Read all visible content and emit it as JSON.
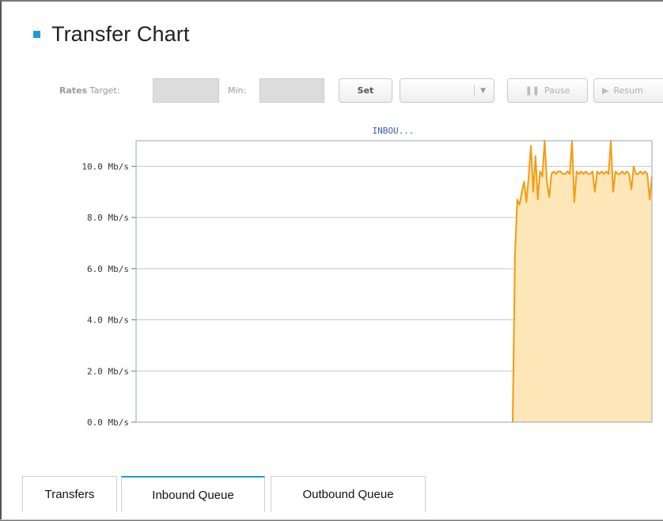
{
  "header": {
    "title": "Transfer Chart"
  },
  "toolbar": {
    "rates_label": "Rates",
    "target_label": "Target:",
    "min_label": "Min:",
    "set_label": "Set",
    "pause_label": "Pause",
    "resume_label": "Resum",
    "target_value": "",
    "min_value": "",
    "select_value": ""
  },
  "icons": {
    "title_bullet": "square-bullet-icon",
    "select_arrow": "chevron-down-icon",
    "pause": "pause-icon",
    "resume": "play-icon"
  },
  "colors": {
    "accent": "#1f9ad8",
    "series_line": "#f39c12",
    "series_fill": "#fde7b8",
    "grid": "#c0c7d6"
  },
  "chart_data": {
    "type": "area",
    "series_label": "INBOU...",
    "y_ticks": [
      "0.0 Mb/s",
      "2.0 Mb/s",
      "4.0 Mb/s",
      "6.0 Mb/s",
      "8.0 Mb/s",
      "10.0 Mb/s"
    ],
    "ylim": [
      0,
      11.0
    ],
    "grid": true,
    "series": [
      {
        "values": [
          0,
          0,
          0,
          0,
          0,
          0,
          0,
          0,
          0,
          0,
          0,
          0,
          0,
          0,
          0,
          0,
          0,
          0,
          0,
          0,
          0,
          0,
          0,
          0,
          0,
          0,
          0,
          0,
          0,
          0,
          0,
          0,
          0,
          0,
          0,
          0,
          0,
          0,
          0,
          0,
          0,
          0,
          0,
          0,
          0,
          0,
          0,
          0,
          0,
          0,
          0,
          0,
          0,
          0,
          0,
          0,
          0,
          0,
          0,
          0,
          0,
          0,
          0,
          0,
          0,
          0,
          0,
          0,
          0,
          0,
          0,
          0,
          0,
          0,
          0,
          0,
          0,
          0,
          0,
          0,
          0,
          0,
          0,
          0,
          0,
          0,
          0,
          0,
          0,
          0,
          0,
          0,
          0,
          0,
          0,
          0,
          0,
          0,
          0,
          0,
          0,
          0,
          0,
          0,
          0,
          0,
          0,
          0,
          0,
          0,
          0,
          0,
          0,
          0,
          0,
          0,
          0,
          0,
          0,
          0,
          0,
          0,
          0,
          0,
          0,
          0,
          0,
          0,
          0,
          0,
          0,
          0,
          0,
          0,
          0,
          0,
          0,
          0,
          0,
          0,
          0,
          0,
          0,
          0,
          0,
          0,
          0,
          0,
          0,
          0,
          0,
          0,
          0,
          0,
          0,
          0,
          0,
          0,
          0,
          0,
          0,
          0,
          0,
          0,
          0,
          0,
          6.5,
          8.7,
          8.5,
          9.0,
          9.4,
          8.6,
          9.6,
          10.8,
          9.0,
          10.4,
          8.7,
          9.8,
          9.6,
          11.0,
          9.4,
          8.8,
          9.7,
          9.8,
          9.7,
          9.8,
          9.8,
          9.7,
          9.7,
          9.8,
          9.7,
          11.0,
          8.6,
          9.8,
          9.7,
          9.8,
          9.7,
          9.8,
          9.7,
          9.7,
          9.8,
          9.0,
          9.8,
          9.7,
          9.8,
          9.7,
          9.8,
          9.7,
          11.0,
          9.0,
          9.8,
          9.7,
          9.7,
          9.8,
          9.7,
          9.8,
          9.7,
          9.1,
          10.0,
          9.7,
          9.7,
          9.8,
          9.7,
          9.8,
          9.7,
          8.7,
          9.6
        ]
      }
    ]
  },
  "tabs": [
    {
      "label": "Transfers"
    },
    {
      "label": "Inbound Queue"
    },
    {
      "label": "Outbound Queue"
    }
  ]
}
